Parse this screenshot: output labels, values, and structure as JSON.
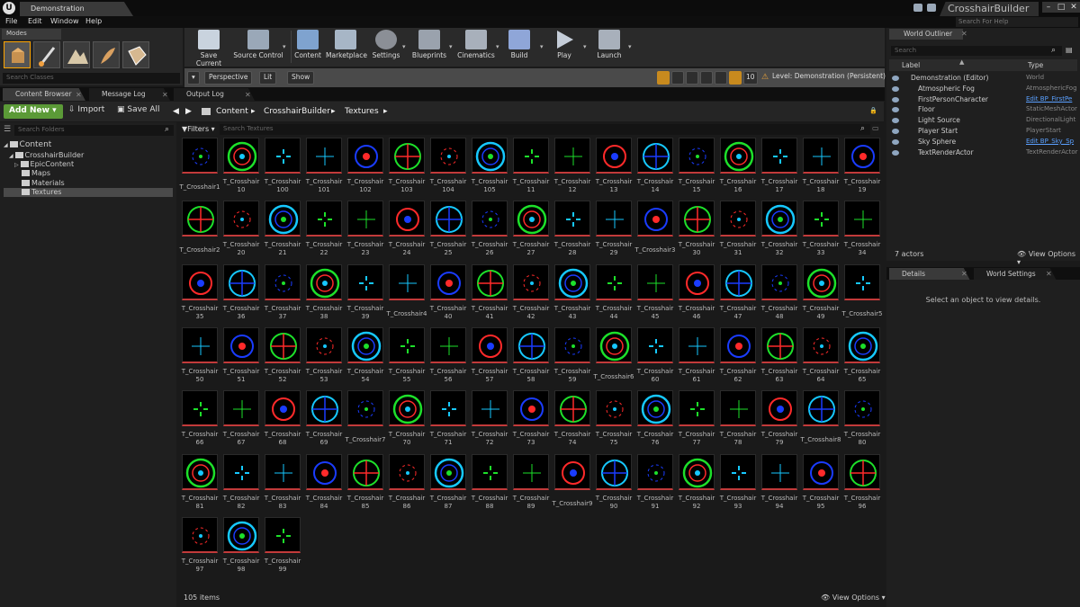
{
  "window": {
    "doc_tab": "Demonstration",
    "project_title": "CrosshairBuilder",
    "min": "–",
    "max": "□",
    "close": "✕"
  },
  "menu": [
    "File",
    "Edit",
    "Window",
    "Help"
  ],
  "help_search_placeholder": "Search For Help",
  "modes": {
    "tab": "Modes",
    "search_placeholder": "Search Classes"
  },
  "toolbar": [
    {
      "label": "Save Current",
      "color": "#c9d3de"
    },
    {
      "label": "Source Control",
      "color": "#9aa8b8"
    },
    {
      "label": "Content",
      "color": "#7fa3cf"
    },
    {
      "label": "Marketplace",
      "color": "#a7b6c6"
    },
    {
      "label": "Settings",
      "color": "#8b8f96"
    },
    {
      "label": "Blueprints",
      "color": "#9aa2ad"
    },
    {
      "label": "Cinematics",
      "color": "#a8b0bb"
    },
    {
      "label": "Build",
      "color": "#8fa6d8"
    },
    {
      "label": "Play",
      "color": "#c5cdd8"
    },
    {
      "label": "Launch",
      "color": "#a8b0bb"
    }
  ],
  "viewport": {
    "perspective": "Perspective",
    "lit": "Lit",
    "show": "Show",
    "camera_speed": "10",
    "level": "Level:  Demonstration (Persistent)"
  },
  "lower_tabs": [
    "Content Browser",
    "Message Log",
    "Output Log"
  ],
  "content_browser": {
    "add_new": "Add New ▾",
    "import": "Import",
    "save_all": "Save All",
    "breadcrumb": [
      "Content",
      "CrosshairBuilder",
      "Textures"
    ],
    "search_folders_placeholder": "Search Folders",
    "filters": "Filters ▾",
    "search_placeholder": "Search Textures",
    "tree": [
      {
        "label": "Content",
        "level": 0
      },
      {
        "label": "CrosshairBuilder",
        "level": 1
      },
      {
        "label": "EpicContent",
        "level": 2
      },
      {
        "label": "Maps",
        "level": 2
      },
      {
        "label": "Materials",
        "level": 2
      },
      {
        "label": "Textures",
        "level": 2
      }
    ],
    "item_count": "105 items",
    "view_options": "View Options ▾",
    "assets": [
      "T_Crosshair1",
      "T_Crosshair 10",
      "T_Crosshair 100",
      "T_Crosshair 101",
      "T_Crosshair 102",
      "T_Crosshair 103",
      "T_Crosshair 104",
      "T_Crosshair 105",
      "T_Crosshair 11",
      "T_Crosshair 12",
      "T_Crosshair 13",
      "T_Crosshair 14",
      "T_Crosshair 15",
      "T_Crosshair 16",
      "T_Crosshair 17",
      "T_Crosshair 18",
      "T_Crosshair 19",
      "T_Crosshair2",
      "T_Crosshair 20",
      "T_Crosshair 21",
      "T_Crosshair 22",
      "T_Crosshair 23",
      "T_Crosshair 24",
      "T_Crosshair 25",
      "T_Crosshair 26",
      "T_Crosshair 27",
      "T_Crosshair 28",
      "T_Crosshair 29",
      "T_Crosshair3",
      "T_Crosshair 30",
      "T_Crosshair 31",
      "T_Crosshair 32",
      "T_Crosshair 33",
      "T_Crosshair 34",
      "T_Crosshair 35",
      "T_Crosshair 36",
      "T_Crosshair 37",
      "T_Crosshair 38",
      "T_Crosshair 39",
      "T_Crosshair4",
      "T_Crosshair 40",
      "T_Crosshair 41",
      "T_Crosshair 42",
      "T_Crosshair 43",
      "T_Crosshair 44",
      "T_Crosshair 45",
      "T_Crosshair 46",
      "T_Crosshair 47",
      "T_Crosshair 48",
      "T_Crosshair 49",
      "T_Crosshair5",
      "T_Crosshair 50",
      "T_Crosshair 51",
      "T_Crosshair 52",
      "T_Crosshair 53",
      "T_Crosshair 54",
      "T_Crosshair 55",
      "T_Crosshair 56",
      "T_Crosshair 57",
      "T_Crosshair 58",
      "T_Crosshair 59",
      "T_Crosshair6",
      "T_Crosshair 60",
      "T_Crosshair 61",
      "T_Crosshair 62",
      "T_Crosshair 63",
      "T_Crosshair 64",
      "T_Crosshair 65",
      "T_Crosshair 66",
      "T_Crosshair 67",
      "T_Crosshair 68",
      "T_Crosshair 69",
      "T_Crosshair7",
      "T_Crosshair 70",
      "T_Crosshair 71",
      "T_Crosshair 72",
      "T_Crosshair 73",
      "T_Crosshair 74",
      "T_Crosshair 75",
      "T_Crosshair 76",
      "T_Crosshair 77",
      "T_Crosshair 78",
      "T_Crosshair 79",
      "T_Crosshair8",
      "T_Crosshair 80",
      "T_Crosshair 81",
      "T_Crosshair 82",
      "T_Crosshair 83",
      "T_Crosshair 84",
      "T_Crosshair 85",
      "T_Crosshair 86",
      "T_Crosshair 87",
      "T_Crosshair 88",
      "T_Crosshair 89",
      "T_Crosshair9",
      "T_Crosshair 90",
      "T_Crosshair 91",
      "T_Crosshair 92",
      "T_Crosshair 93",
      "T_Crosshair 94",
      "T_Crosshair 95",
      "T_Crosshair 96",
      "T_Crosshair 97",
      "T_Crosshair 98",
      "T_Crosshair 99"
    ]
  },
  "outliner": {
    "tab": "World Outliner",
    "search_placeholder": "Search",
    "col_label": "Label",
    "col_type": "Type",
    "rows": [
      {
        "label": "Demonstration (Editor)",
        "type": "World",
        "link": false
      },
      {
        "label": "Atmospheric Fog",
        "type": "AtmosphericFog",
        "link": false
      },
      {
        "label": "FirstPersonCharacter",
        "type": "Edit BP_FirstPe",
        "link": true
      },
      {
        "label": "Floor",
        "type": "StaticMeshActor",
        "link": false
      },
      {
        "label": "Light Source",
        "type": "DirectionalLight",
        "link": false
      },
      {
        "label": "Player Start",
        "type": "PlayerStart",
        "link": false
      },
      {
        "label": "Sky Sphere",
        "type": "Edit BP_Sky_Sp",
        "link": true
      },
      {
        "label": "TextRenderActor",
        "type": "TextRenderActor",
        "link": false
      }
    ],
    "actors_count": "7 actors",
    "view_options": "View Options ▾"
  },
  "details": {
    "tabs": [
      "Details",
      "World Settings"
    ],
    "message": "Select an object to view details."
  },
  "colors": {
    "accent_green": "#5b9a37",
    "thumb_underline": "#c23a3a",
    "link_blue": "#5aa0ff",
    "selection_orange": "#ffa500"
  }
}
